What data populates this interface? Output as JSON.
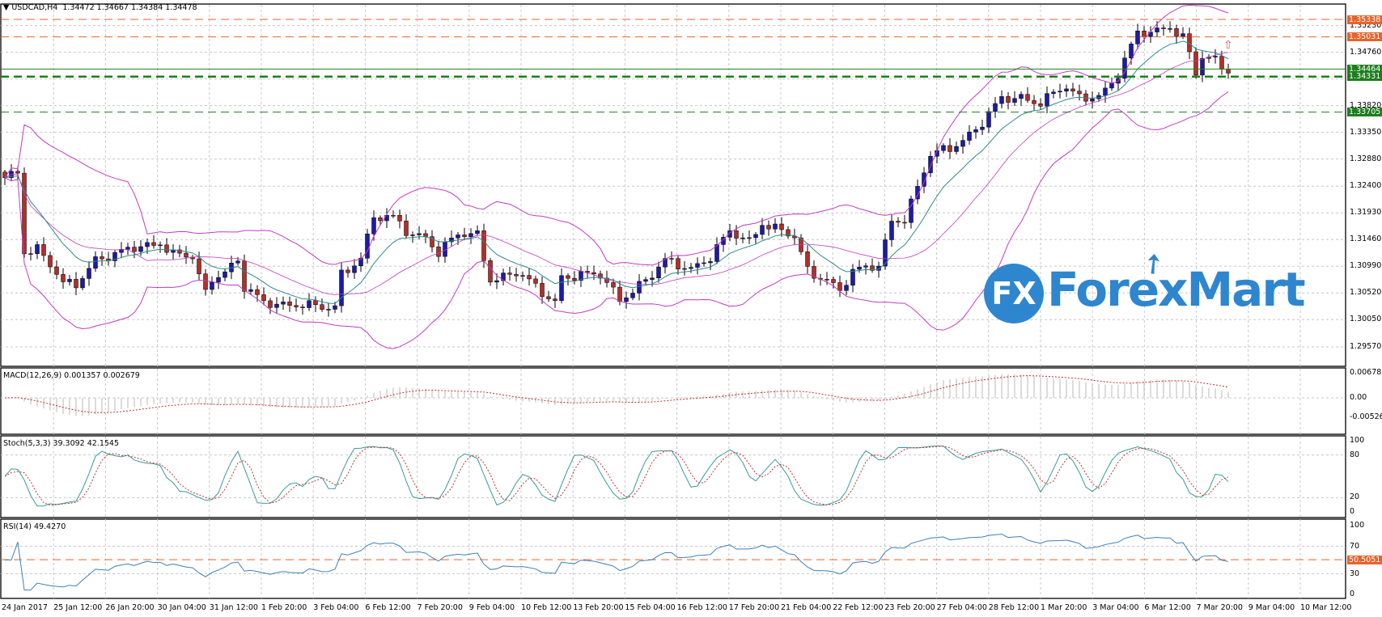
{
  "header": {
    "symbol": "USDCAD,H4",
    "ohlc": "1.34472 1.34667 1.34384 1.34478"
  },
  "colors": {
    "bull": "#1c1ca0",
    "bear": "#b0302a",
    "bands": "#c23bc2",
    "ma": "#2f8a8a",
    "orange_level": "#e8632a",
    "green_level": "#1e7d1e",
    "logo": "#2e86cf"
  },
  "logo": {
    "text": "ForexMart",
    "badge": "FX"
  },
  "chart_data": [
    {
      "type": "candlestick",
      "title": "USDCAD,H4",
      "price_axis": {
        "min": 1.2957,
        "max": 1.35338,
        "ticks": [
          "1.35230",
          "1.34760",
          "1.34290",
          "1.33820",
          "1.33350",
          "1.32880",
          "1.32400",
          "1.31930",
          "1.31460",
          "1.30990",
          "1.30520",
          "1.30050",
          "1.29570"
        ]
      },
      "levels": [
        {
          "value": "1.35338",
          "kind": "orange"
        },
        {
          "value": "1.35031",
          "kind": "orange"
        },
        {
          "value": "1.34464",
          "kind": "green"
        },
        {
          "value": "1.34331",
          "kind": "green-thick"
        },
        {
          "value": "1.33705",
          "kind": "green"
        }
      ],
      "close_path": [
        [
          0,
          1.3255
        ],
        [
          2,
          1.327
        ],
        [
          3,
          1.313
        ],
        [
          5,
          1.313
        ],
        [
          9,
          1.3065
        ],
        [
          11,
          1.307
        ],
        [
          14,
          1.3115
        ],
        [
          17,
          1.3115
        ],
        [
          21,
          1.3135
        ],
        [
          24,
          1.3145
        ],
        [
          26,
          1.312
        ],
        [
          29,
          1.311
        ],
        [
          31,
          1.305
        ],
        [
          32,
          1.308
        ],
        [
          36,
          1.311
        ],
        [
          37,
          1.306
        ],
        [
          40,
          1.303
        ],
        [
          42,
          1.3035
        ],
        [
          46,
          1.3035
        ],
        [
          49,
          1.302
        ],
        [
          51,
          1.3025
        ],
        [
          52,
          1.3085
        ],
        [
          55,
          1.312
        ],
        [
          57,
          1.3185
        ],
        [
          60,
          1.318
        ],
        [
          62,
          1.316
        ],
        [
          65,
          1.3155
        ],
        [
          67,
          1.3125
        ],
        [
          70,
          1.315
        ],
        [
          73,
          1.3155
        ],
        [
          75,
          1.308
        ],
        [
          79,
          1.3085
        ],
        [
          82,
          1.306
        ],
        [
          85,
          1.304
        ],
        [
          86,
          1.3085
        ],
        [
          90,
          1.308
        ],
        [
          92,
          1.308
        ],
        [
          95,
          1.3045
        ],
        [
          97,
          1.306
        ],
        [
          100,
          1.308
        ],
        [
          102,
          1.3105
        ],
        [
          106,
          1.31
        ],
        [
          109,
          1.3115
        ],
        [
          112,
          1.3155
        ],
        [
          115,
          1.3145
        ],
        [
          117,
          1.318
        ],
        [
          120,
          1.316
        ],
        [
          122,
          1.3145
        ],
        [
          124,
          1.309
        ],
        [
          127,
          1.308
        ],
        [
          129,
          1.306
        ],
        [
          131,
          1.3085
        ],
        [
          135,
          1.31
        ],
        [
          137,
          1.3185
        ],
        [
          139,
          1.3185
        ],
        [
          141,
          1.3235
        ],
        [
          143,
          1.329
        ],
        [
          146,
          1.331
        ],
        [
          151,
          1.335
        ],
        [
          154,
          1.339
        ],
        [
          157,
          1.34
        ],
        [
          160,
          1.339
        ],
        [
          164,
          1.341
        ],
        [
          166,
          1.3395
        ],
        [
          170,
          1.341
        ],
        [
          172,
          1.3435
        ],
        [
          175,
          1.3505
        ],
        [
          177,
          1.3515
        ],
        [
          180,
          1.3525
        ],
        [
          182,
          1.35
        ],
        [
          183,
          1.347
        ],
        [
          184,
          1.3432
        ],
        [
          185,
          1.3465
        ],
        [
          187,
          1.3462
        ],
        [
          189,
          1.3448
        ]
      ],
      "x_ticks": [
        "24 Jan 2017",
        "25 Jan 12:00",
        "26 Jan 20:00",
        "30 Jan 04:00",
        "31 Jan 12:00",
        "1 Feb 20:00",
        "3 Feb 04:00",
        "6 Feb 12:00",
        "7 Feb 20:00",
        "9 Feb 04:00",
        "10 Feb 12:00",
        "13 Feb 20:00",
        "15 Feb 04:00",
        "16 Feb 12:00",
        "17 Feb 20:00",
        "21 Feb 04:00",
        "22 Feb 12:00",
        "23 Feb 20:00",
        "27 Feb 04:00",
        "28 Feb 12:00",
        "1 Mar 20:00",
        "3 Mar 04:00",
        "6 Mar 12:00",
        "7 Mar 20:00",
        "9 Mar 04:00",
        "10 Mar 12:00"
      ]
    },
    {
      "type": "histogram+line",
      "label": "MACD(12,26,9) 0.001357 0.002679",
      "ticks": [
        "0.006783",
        "0.00",
        "-0.005265"
      ],
      "ylim": [
        -0.005265,
        0.006783
      ]
    },
    {
      "type": "line",
      "label": "Stoch(5,3,3) 39.3092 42.1545",
      "ticks": [
        "100",
        "80",
        "20",
        "0"
      ],
      "ylim": [
        0,
        100
      ]
    },
    {
      "type": "line",
      "label": "RSI(14) 49.4270",
      "ticks": [
        "100",
        "70",
        "30",
        "0"
      ],
      "level": "50.5051",
      "ylim": [
        0,
        100
      ]
    }
  ]
}
